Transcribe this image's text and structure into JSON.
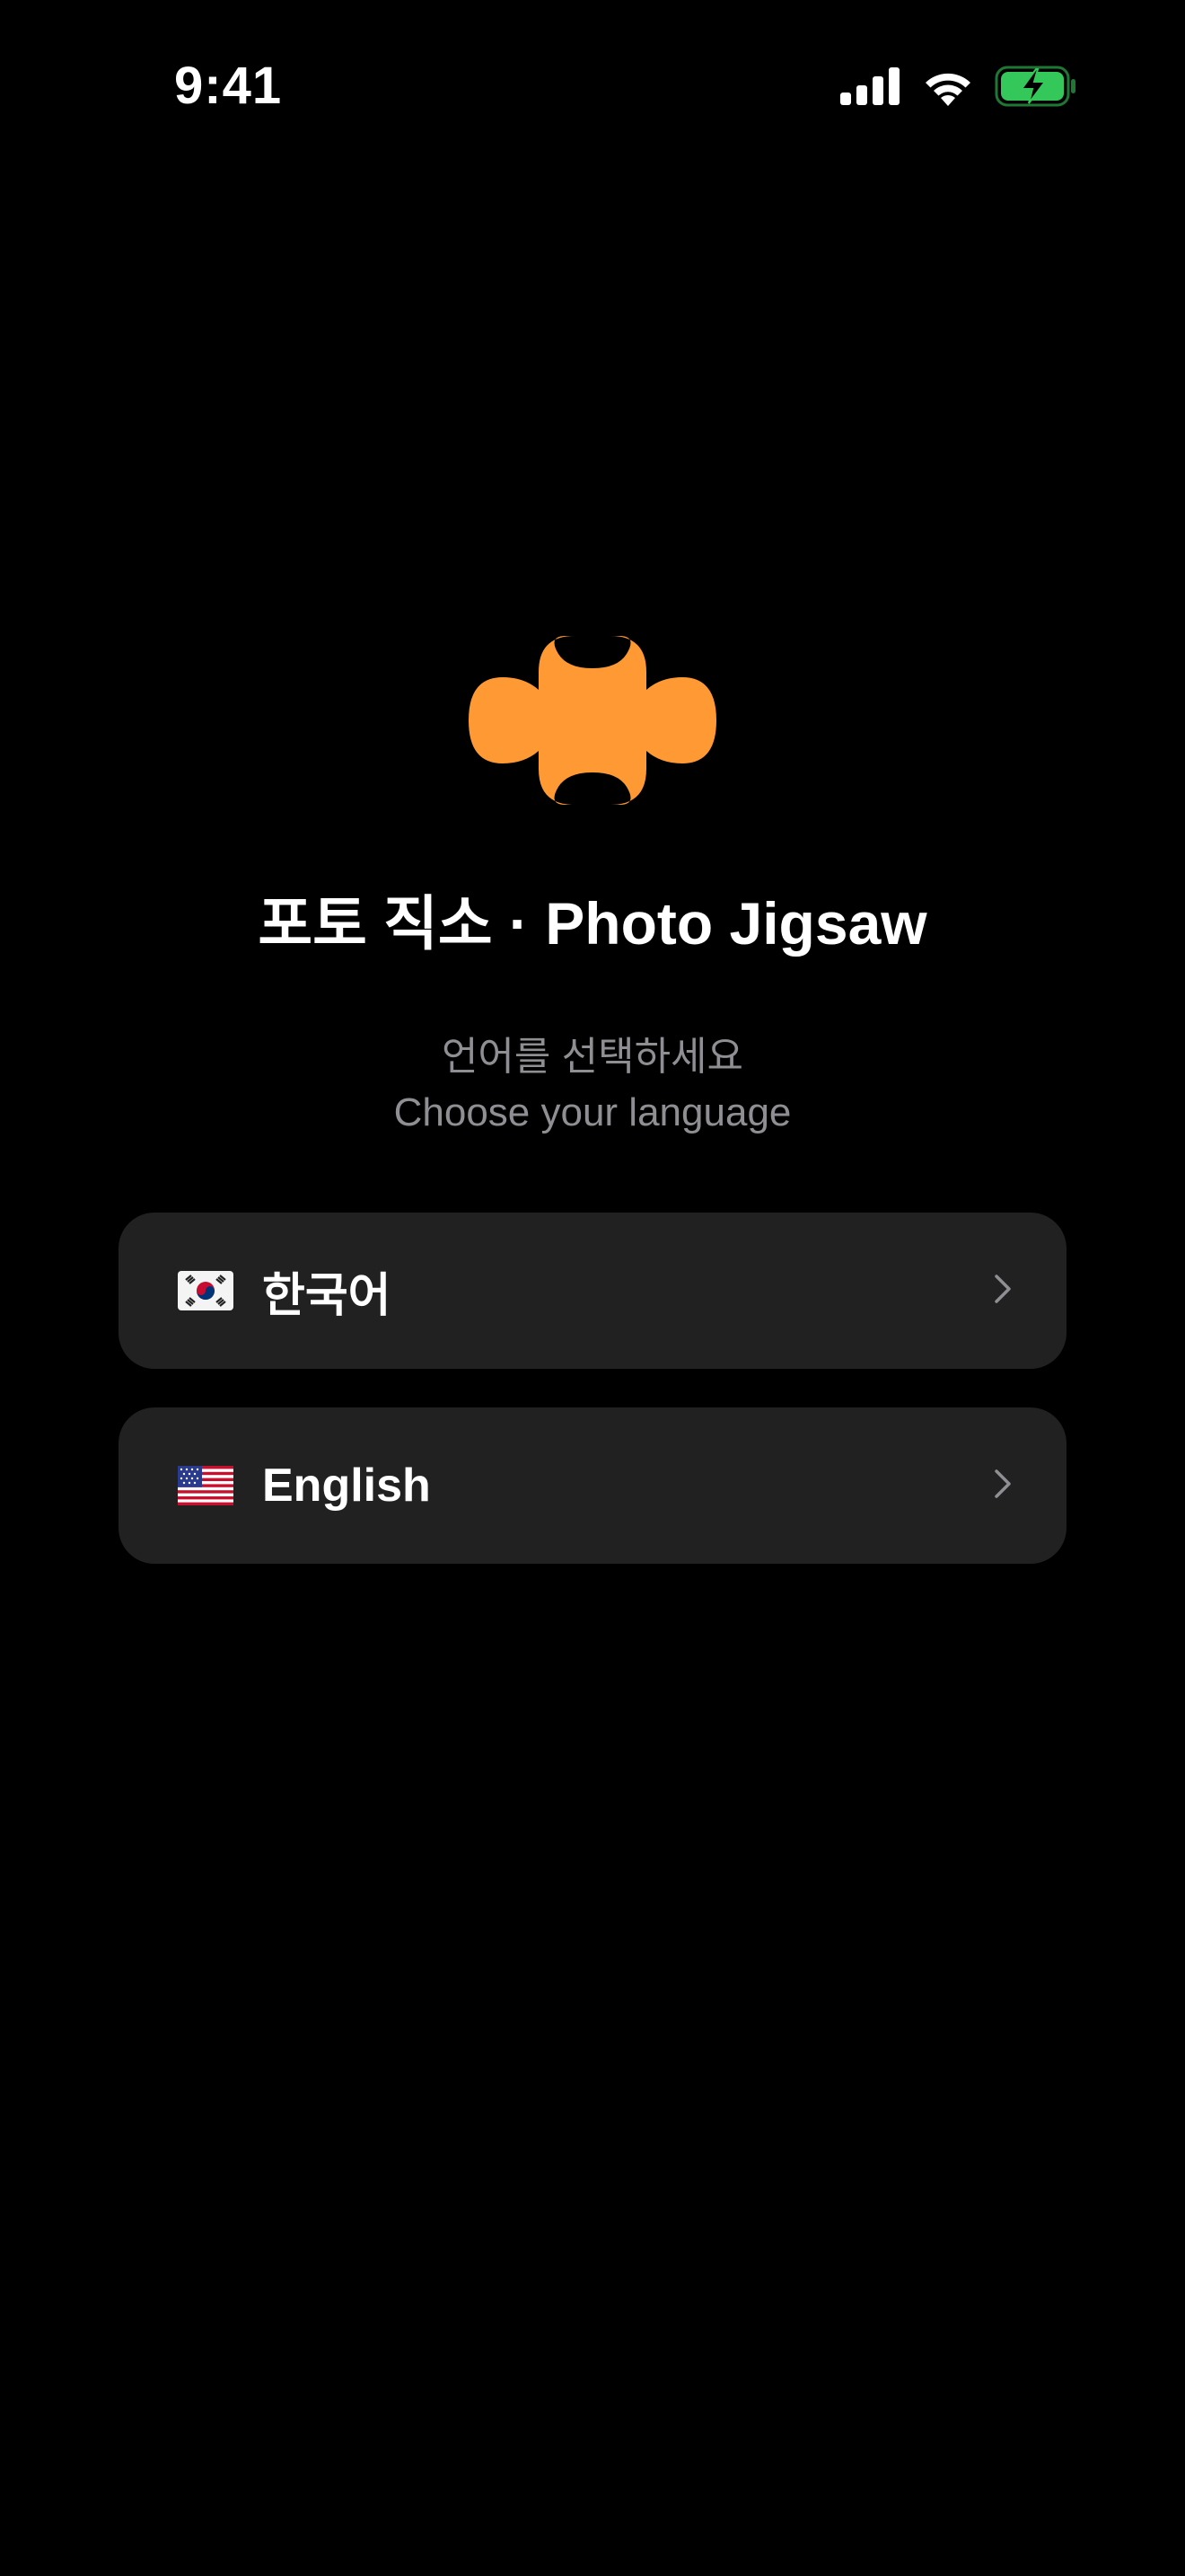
{
  "status_bar": {
    "time": "9:41",
    "icons": [
      "cellular-signal-icon",
      "wifi-icon",
      "battery-charging-icon"
    ],
    "battery_color": "#34c759"
  },
  "app": {
    "icon": "puzzle-piece-icon",
    "icon_color": "#ff9933",
    "title": "포토 직소 · Photo Jigsaw"
  },
  "prompt": {
    "korean": "언어를 선택하세요",
    "english": "Choose your language"
  },
  "languages": [
    {
      "label": "한국어",
      "flag_icon": "south-korea-flag-icon",
      "chevron_icon": "chevron-right-icon"
    },
    {
      "label": "English",
      "flag_icon": "us-flag-icon",
      "chevron_icon": "chevron-right-icon"
    }
  ],
  "colors": {
    "background": "#000000",
    "button_background": "#212121",
    "subtitle_text": "#8e8e93",
    "chevron": "#8e8e93"
  }
}
